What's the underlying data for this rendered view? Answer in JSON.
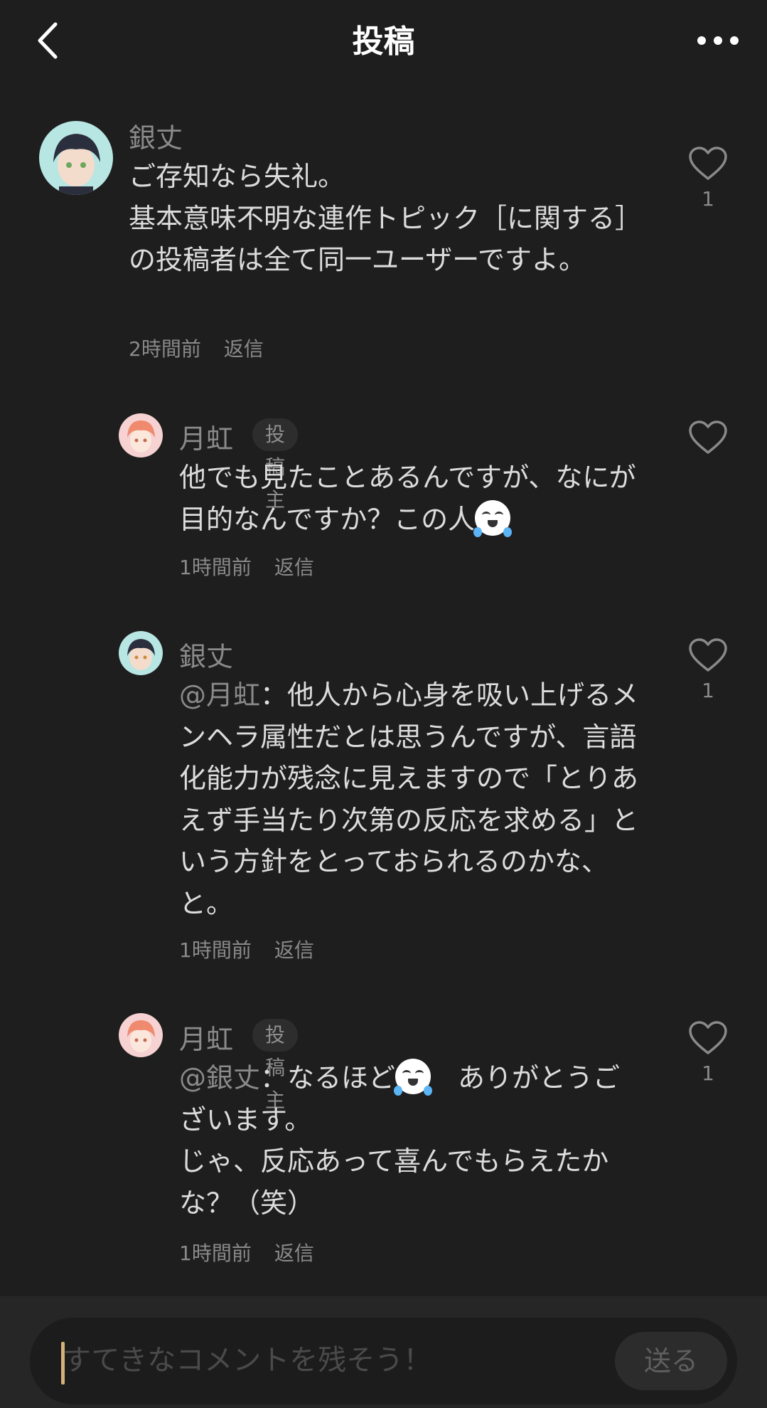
{
  "header": {
    "title": "投稿"
  },
  "comments": [
    {
      "author": "銀丈",
      "text": "ご存知なら失礼。\n基本意味不明な連作トピック［に関する］の投稿者は全て同一ユーザーですよ。",
      "time": "2時間前",
      "reply_label": "返信",
      "likes": "1"
    },
    {
      "author": "月虹",
      "badge": "投稿主",
      "text": "他でも見たことあるんですが、なにが目的なんですか？この人",
      "emoji": "crying-laughing-emoji",
      "time": "1時間前",
      "reply_label": "返信"
    },
    {
      "author": "銀丈",
      "mention": "@月虹",
      "text": "：他人から心身を吸い上げるメンヘラ属性だとは思うんですが、言語化能力が残念に見えますので「とりあえず手当たり次第の反応を求める」という方針をとっておられるのかな、と。",
      "time": "1時間前",
      "reply_label": "返信",
      "likes": "1"
    },
    {
      "author": "月虹",
      "badge": "投稿主",
      "mention": "@銀丈",
      "text_before_emoji": "：なるほど",
      "emoji": "crying-laughing-emoji",
      "text_after_emoji": "　ありがとうございます。\nじゃ、反応あって喜んでもらえたかな？（笑）",
      "time": "1時間前",
      "reply_label": "返信",
      "likes": "1"
    }
  ],
  "footer": {
    "input_placeholder": "すてきなコメントを残そう！",
    "send_label": "送る"
  },
  "colors": {
    "background": "#1e1e1e",
    "accent_caret": "#d4b07a"
  }
}
